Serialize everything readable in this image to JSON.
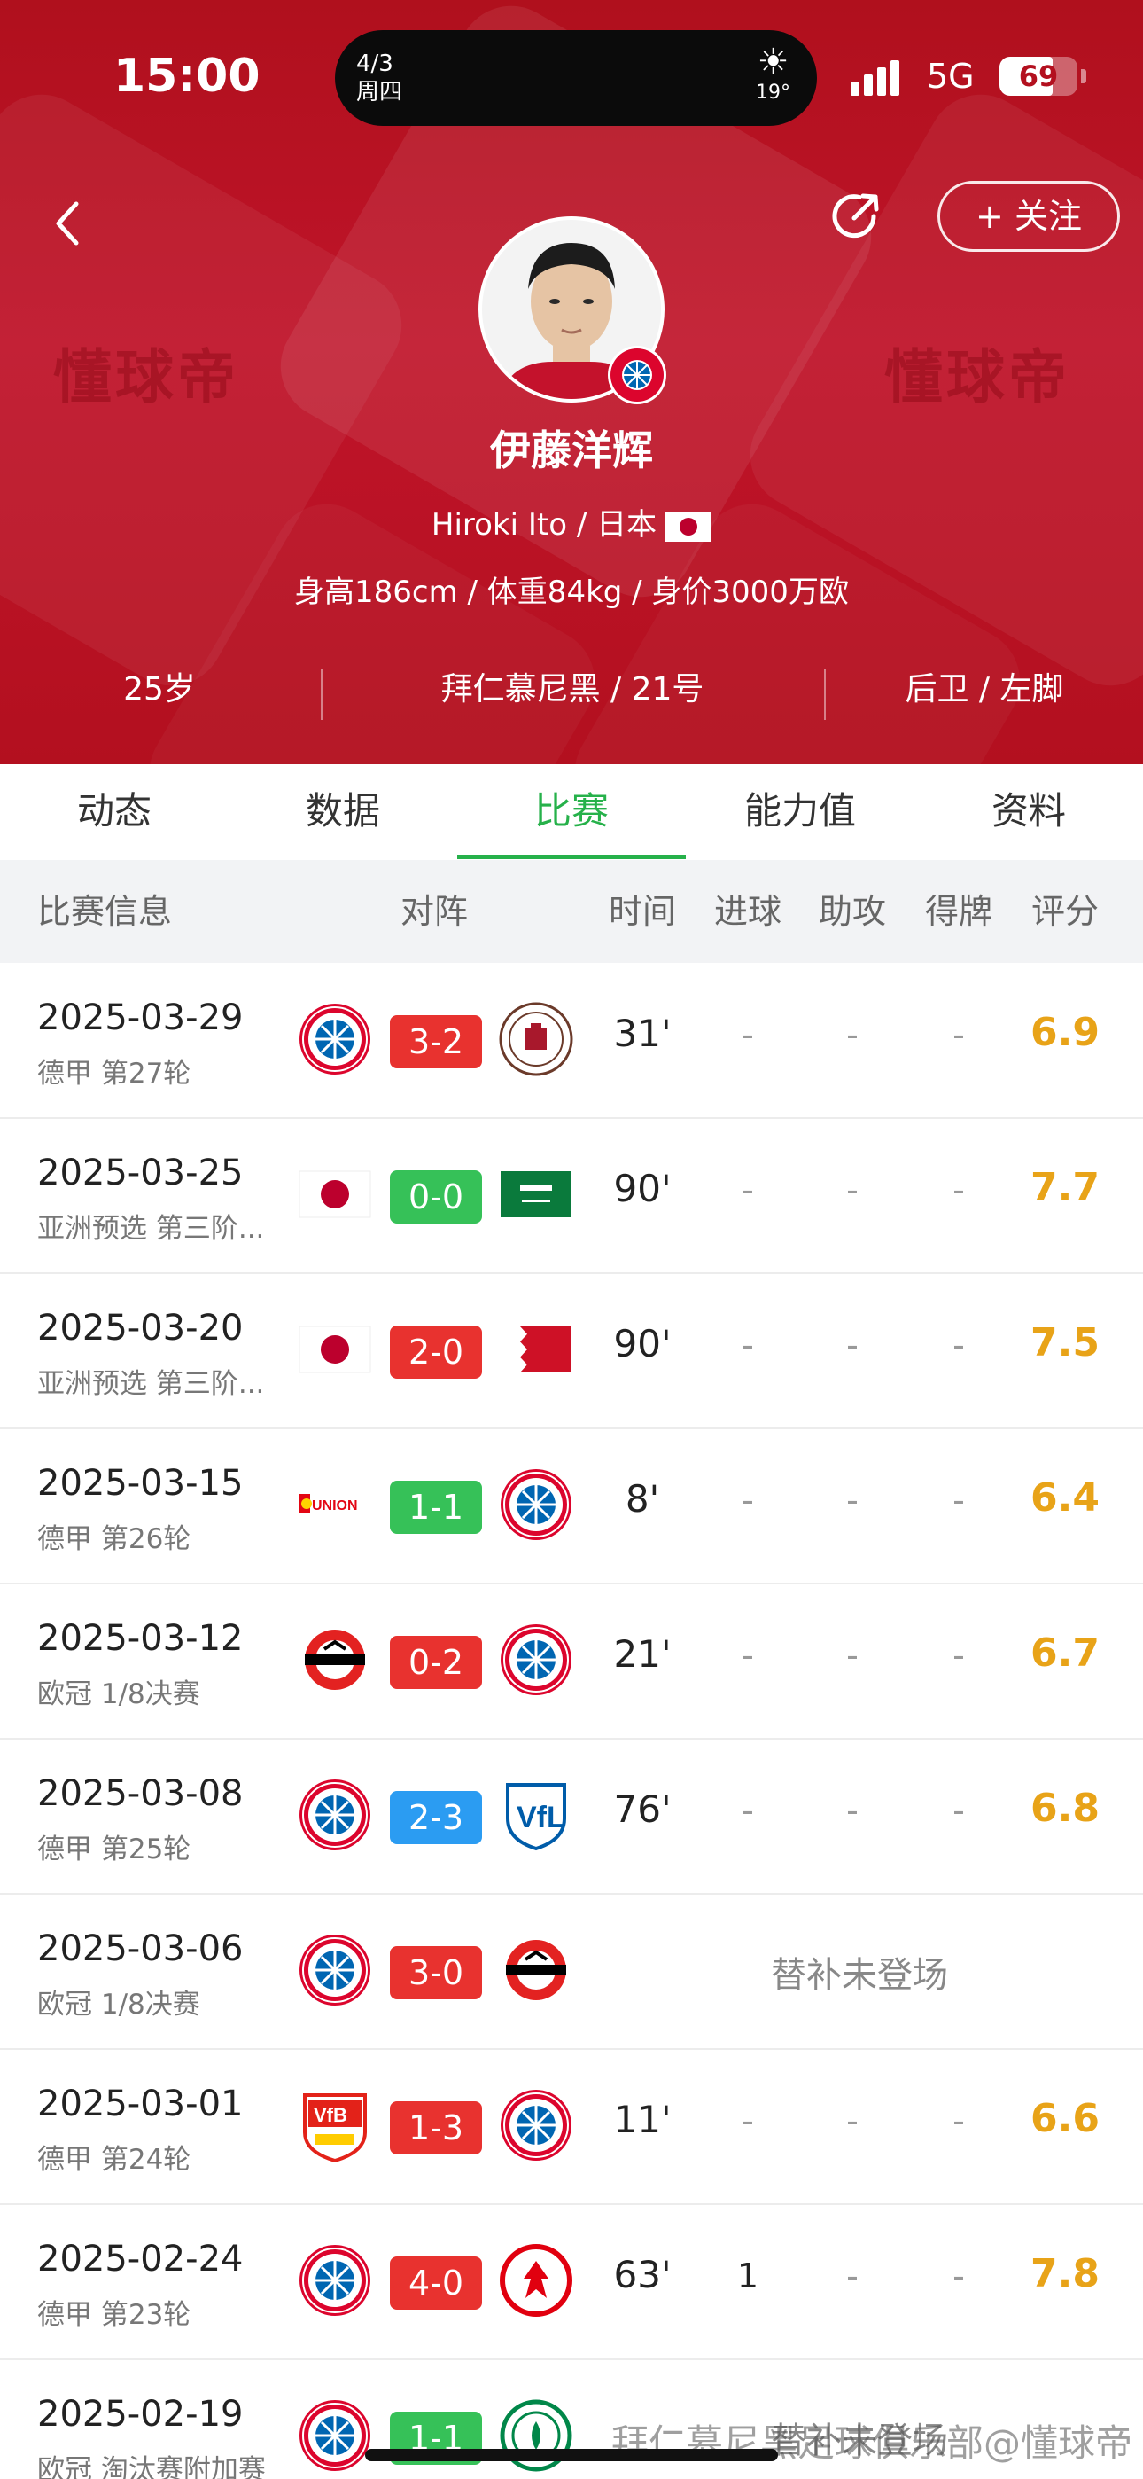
{
  "status_bar": {
    "time": "15:00",
    "island_date": "4/3",
    "island_weekday": "周四",
    "temperature": "19°",
    "network": "5G",
    "battery": "69"
  },
  "header": {
    "follow_label": "+ 关注",
    "watermark": "懂球帝",
    "player": {
      "name": "伊藤洋辉",
      "english_name": "Hiroki Ito / 日本",
      "stats": "身高186cm / 体重84kg / 身价3000万欧",
      "age": "25岁",
      "club": "拜仁慕尼黑 / 21号",
      "position": "后卫 / 左脚"
    }
  },
  "tabs": [
    {
      "label": "动态",
      "active": false
    },
    {
      "label": "数据",
      "active": false
    },
    {
      "label": "比赛",
      "active": true
    },
    {
      "label": "能力值",
      "active": false
    },
    {
      "label": "资料",
      "active": false
    }
  ],
  "table": {
    "headers": {
      "info": "比赛信息",
      "matchup": "对阵",
      "time": "时间",
      "goals": "进球",
      "assists": "助攻",
      "cards": "得牌",
      "rating": "评分"
    },
    "rows": [
      {
        "date": "2025-03-29",
        "competition": "德甲 第27轮",
        "home": "bayern",
        "away": "stpauli",
        "score": "3-2",
        "result": "red",
        "minutes": "31'",
        "goals": "-",
        "assists": "-",
        "cards": "-",
        "rating": "6.9"
      },
      {
        "date": "2025-03-25",
        "competition": "亚洲预选 第三阶...",
        "home": "japan",
        "away": "saudi",
        "score": "0-0",
        "result": "green",
        "minutes": "90'",
        "goals": "-",
        "assists": "-",
        "cards": "-",
        "rating": "7.7"
      },
      {
        "date": "2025-03-20",
        "competition": "亚洲预选 第三阶...",
        "home": "japan",
        "away": "bahrain",
        "score": "2-0",
        "result": "red",
        "minutes": "90'",
        "goals": "-",
        "assists": "-",
        "cards": "-",
        "rating": "7.5"
      },
      {
        "date": "2025-03-15",
        "competition": "德甲 第26轮",
        "home": "union",
        "away": "bayern",
        "score": "1-1",
        "result": "green",
        "minutes": "8'",
        "goals": "-",
        "assists": "-",
        "cards": "-",
        "rating": "6.4"
      },
      {
        "date": "2025-03-12",
        "competition": "欧冠 1/8决赛",
        "home": "leverkusen",
        "away": "bayern",
        "score": "0-2",
        "result": "red",
        "minutes": "21'",
        "goals": "-",
        "assists": "-",
        "cards": "-",
        "rating": "6.7"
      },
      {
        "date": "2025-03-08",
        "competition": "德甲 第25轮",
        "home": "bayern",
        "away": "bochum",
        "score": "2-3",
        "result": "blue",
        "minutes": "76'",
        "goals": "-",
        "assists": "-",
        "cards": "-",
        "rating": "6.8"
      },
      {
        "date": "2025-03-06",
        "competition": "欧冠 1/8决赛",
        "home": "bayern",
        "away": "leverkusen",
        "score": "3-0",
        "result": "red",
        "dnp": "替补未登场"
      },
      {
        "date": "2025-03-01",
        "competition": "德甲 第24轮",
        "home": "stuttgart",
        "away": "bayern",
        "score": "1-3",
        "result": "red",
        "minutes": "11'",
        "goals": "-",
        "assists": "-",
        "cards": "-",
        "rating": "6.6"
      },
      {
        "date": "2025-02-24",
        "competition": "德甲 第23轮",
        "home": "bayern",
        "away": "frankfurt",
        "score": "4-0",
        "result": "red",
        "minutes": "63'",
        "goals": "1",
        "assists": "-",
        "cards": "-",
        "rating": "7.8"
      },
      {
        "date": "2025-02-19",
        "competition": "欧冠 淘汰赛附加赛",
        "home": "bayern",
        "away": "celtic",
        "score": "1-1",
        "result": "green",
        "dnp": "替补未登场"
      }
    ]
  },
  "footer_watermark": "拜仁慕尼黑足球俱乐部@懂球帝",
  "colors": {
    "brand_red": "#b3101f",
    "accent_green": "#26b14a",
    "score_red": "#e8322f",
    "score_green": "#36c158",
    "score_blue": "#2b9cf2",
    "rating_orange": "#e8a318"
  }
}
